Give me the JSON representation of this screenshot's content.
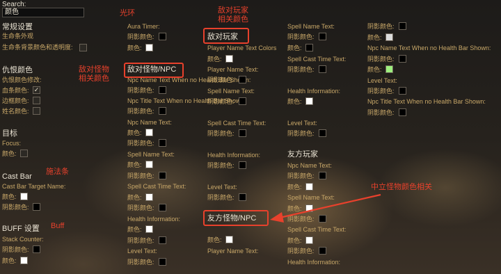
{
  "search": {
    "label": "Search:",
    "value": "颜色"
  },
  "left": {
    "general_header": "常规设置",
    "life_appearance": "生命条外观",
    "health_bg_color": "生命条背景颜色和透明度:",
    "aggro_header": "仇恨颜色",
    "aggro_modify": "仇恨颜色修改:",
    "health_color": "血条颜色:",
    "border_color": "边框颜色:",
    "name_color": "姓名颜色:",
    "target_header": "目标",
    "focus": "Focus:",
    "focus_color": "颜色:",
    "castbar_header": "Cast Bar",
    "castbar_target_name": "Cast Bar Target Name:",
    "castbar_color": "颜色:",
    "castbar_shadow": "阴影颜色:",
    "buff_header": "BUFF 设置",
    "stack_counter": "Stack Counter:",
    "buff_shadow": "阴影颜色:",
    "buff_color": "颜色:"
  },
  "col2": {
    "aura_timer": "Aura Timer:",
    "shadow1": "阴影颜色:",
    "color1": "颜色:",
    "hostile_header": "敌对怪物/NPC",
    "npc_name_text": "Npc Name Text When no Health Bar Shown:",
    "shadow2": "阴影颜色:",
    "npc_title_text": "Npc Title Text When no Health Bar Shown:",
    "shadow3": "阴影颜色:",
    "npc_name": "Npc Name Text:",
    "color2": "颜色:",
    "shadow4": "阴影颜色:",
    "spell_name": "Spell Name Text:",
    "color3": "颜色:",
    "shadow5": "阴影颜色:",
    "spell_cast": "Spell Cast Time Text:",
    "color4": "颜色:",
    "shadow6": "阴影颜色:",
    "health_info": "Health Information:",
    "color5": "颜色:",
    "shadow7": "阴影颜色:",
    "level_text": "Level Text:",
    "shadow8": "阴影颜色:"
  },
  "col3": {
    "hostile_player_header": "敌对玩家",
    "player_name_colors": "Player Name Text Colors",
    "color1": "颜色:",
    "player_name": "Player Name Text:",
    "shadow1": "阴影颜色:",
    "spell_name": "Spell Name Text:",
    "shadow2": "阴影颜色:",
    "spell_cast": "Spell Cast Time Text:",
    "shadow3": "阴影颜色:",
    "health_info": "Health Information:",
    "shadow4": "阴影颜色:",
    "level_text": "Level Text:",
    "shadow5": "阴影颜色:",
    "friendly_header": "友方怪物/NPC",
    "color2": "颜色:",
    "player_name2": "Player Name Text:"
  },
  "col4": {
    "spell_name": "Spell Name Text:",
    "shadow1": "阴影颜色:",
    "color1": "颜色:",
    "spell_cast": "Spell Cast Time Text:",
    "shadow2": "阴影颜色:",
    "health_info": "Health Information:",
    "color2": "颜色:",
    "level_text": "Level Text:",
    "shadow3": "阴影颜色:",
    "friendly_player_header": "友方玩家",
    "npc_name": "Npc Name Text:",
    "shadow4": "阴影颜色:",
    "color3": "颜色:",
    "spell_name2": "Spell Name Text:",
    "color4": "颜色:",
    "shadow5": "阴影颜色:",
    "spell_cast2": "Spell Cast Time Text:",
    "color5": "颜色:",
    "shadow6": "阴影颜色:",
    "health_info2": "Health Information:"
  },
  "col5": {
    "shadow1": "阴影颜色:",
    "color1": "颜色:",
    "npc_name_text": "Npc Name Text When no Health Bar Shown:",
    "shadow2": "阴影颜色:",
    "color2": "颜色:",
    "level_text": "Level Text:",
    "shadow3": "阴影颜色:",
    "npc_title_text": "Npc Title Text When no Health Bar Shown:",
    "shadow4": "阴影颜色:"
  },
  "annotations": {
    "halo": "光环",
    "hostile_player": "敌对玩家\n相关颜色",
    "hostile_monster": "敌对怪物\n相关颜色",
    "castbar": "施法条",
    "buff": "Buff",
    "neutral": "中立怪物颜色相关"
  },
  "colors": {
    "label": "#c9a869",
    "header": "#e9e2d2",
    "annotation": "#e8412c",
    "swatch_green": "#9ef07f"
  },
  "checkmark": "✓"
}
